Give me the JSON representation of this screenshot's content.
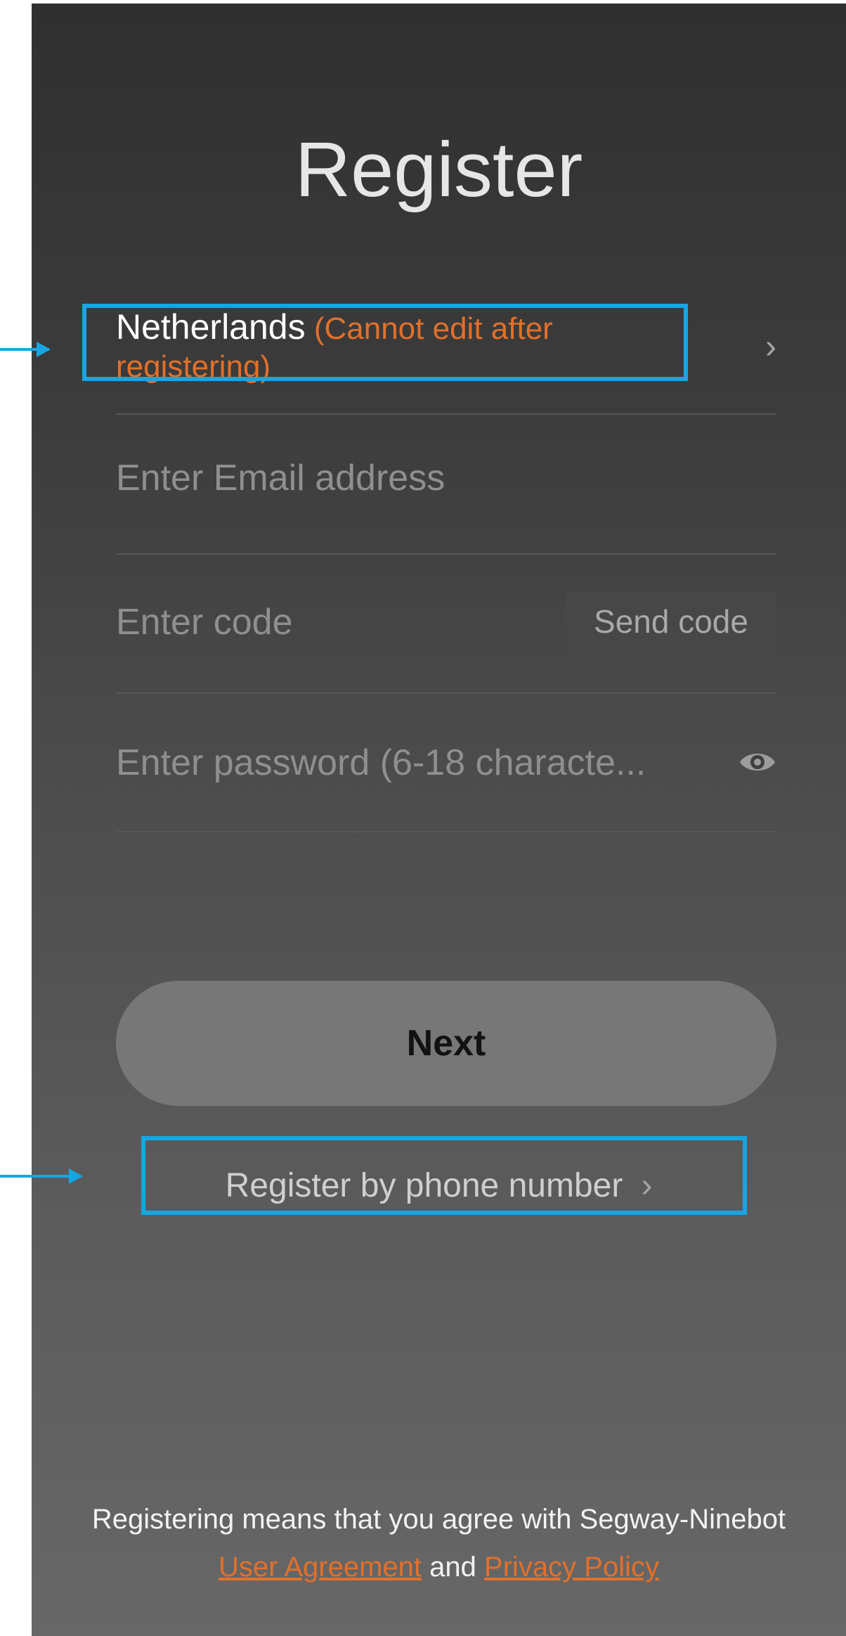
{
  "screen": {
    "title": "Register"
  },
  "country": {
    "name": "Netherlands",
    "note": "(Cannot edit after registering)",
    "chevron": "›"
  },
  "email": {
    "placeholder": "Enter Email address"
  },
  "code": {
    "placeholder": "Enter code",
    "send_label": "Send code"
  },
  "password": {
    "placeholder": "Enter password (6-18 characte...",
    "eye_icon": "eye-icon"
  },
  "next_button": {
    "label": "Next"
  },
  "phone_register": {
    "label": "Register by phone number",
    "chevron": "›"
  },
  "legal": {
    "prefix": "Registering means that you agree with Segway-Ninebot",
    "user_agreement": "User Agreement",
    "connector": "and",
    "privacy_policy": "Privacy Policy"
  },
  "colors": {
    "accent_orange": "#e2702a",
    "callout_blue": "#16a6e3"
  }
}
